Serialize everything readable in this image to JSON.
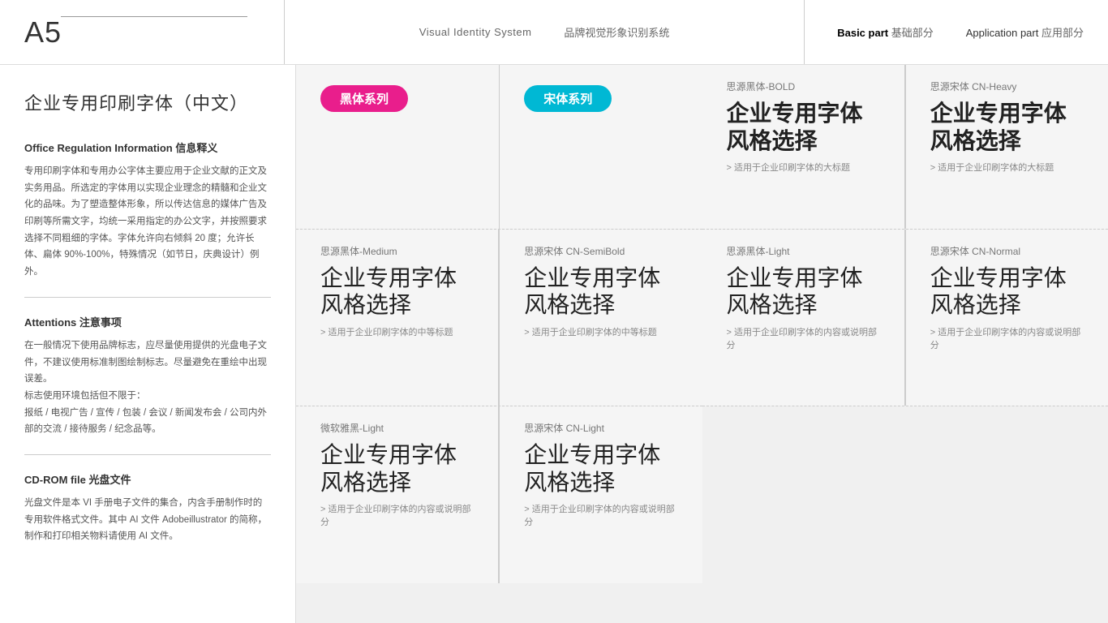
{
  "header": {
    "page_id": "A5",
    "center_en": "Visual Identity System",
    "center_cn": "品牌视觉形象识别系统",
    "nav_basic_en": "Basic part",
    "nav_basic_cn": "基础部分",
    "nav_app_en": "Application part",
    "nav_app_cn": "应用部分"
  },
  "sidebar": {
    "title": "企业专用印刷字体（中文）",
    "section1": {
      "title": "Office Regulation Information 信息释义",
      "body": "专用印刷字体和专用办公字体主要应用于企业文献的正文及实务用品。所选定的字体用以实现企业理念的精髓和企业文化的品味。为了塑造整体形象，所以传达信息的媒体广告及印刷等所需文字，均统一采用指定的办公文字，并按照要求选择不同粗细的字体。字体允许向右倾斜 20 度；允许长体、扁体 90%-100%，特殊情况（如节日，庆典设计）例外。"
    },
    "section2": {
      "title": "Attentions 注意事项",
      "body1": "在一般情况下使用品牌标志，应尽量使用提供的光盘电子文件，不建议使用标准制图绘制标志。尽量避免在重绘中出现误差。",
      "body2": "标志使用环境包括但不限于：",
      "body3": "报纸 / 电视广告 / 宣传 / 包装 / 会议 / 新闻发布会 / 公司内外部的交流 / 接待服务 / 纪念品等。"
    },
    "section3": {
      "title": "CD-ROM file 光盘文件",
      "body": "光盘文件是本 VI 手册电子文件的集合，内含手册制作时的专用软件格式文件。其中 AI 文件 Adobeillustrator 的简称，制作和打印相关物料请使用 AI 文件。"
    }
  },
  "content": {
    "left_tag": "黑体系列",
    "right_tag": "宋体系列",
    "rows": [
      {
        "left": {
          "name": "思源黑体-BOLD",
          "sample": "企业专用字体风格选择",
          "weight": "bold",
          "desc": "适用于企业印刷字体的大标题"
        },
        "right": {
          "name": "思源宋体 CN-Heavy",
          "sample": "企业专用字体风格选择",
          "weight": "bold",
          "desc": "适用于企业印刷字体的大标题"
        }
      },
      {
        "left": {
          "name": "思源黑体-Medium",
          "sample": "企业专用字体风格选择",
          "weight": "medium",
          "desc": "适用于企业印刷字体的中等标题"
        },
        "right": {
          "name": "思源宋体 CN-SemiBold",
          "sample": "企业专用字体风格选择",
          "weight": "medium",
          "desc": "适用于企业印刷字体的中等标题"
        }
      },
      {
        "left": {
          "name": "思源黑体-Light",
          "sample": "企业专用字体风格选择",
          "weight": "light",
          "desc": "适用于企业印刷字体的内容或说明部分"
        },
        "right": {
          "name": "思源宋体 CN-Normal",
          "sample": "企业专用字体风格选择",
          "weight": "light",
          "desc": "适用于企业印刷字体的内容或说明部分"
        }
      },
      {
        "left": {
          "name": "微软雅黑-Light",
          "sample": "企业专用字体风格选择",
          "weight": "light",
          "desc": "适用于企业印刷字体的内容或说明部分"
        },
        "right": {
          "name": "思源宋体 CN-Light",
          "sample": "企业专用字体风格选择",
          "weight": "light",
          "desc": "适用于企业印刷字体的内容或说明部分"
        }
      }
    ]
  }
}
